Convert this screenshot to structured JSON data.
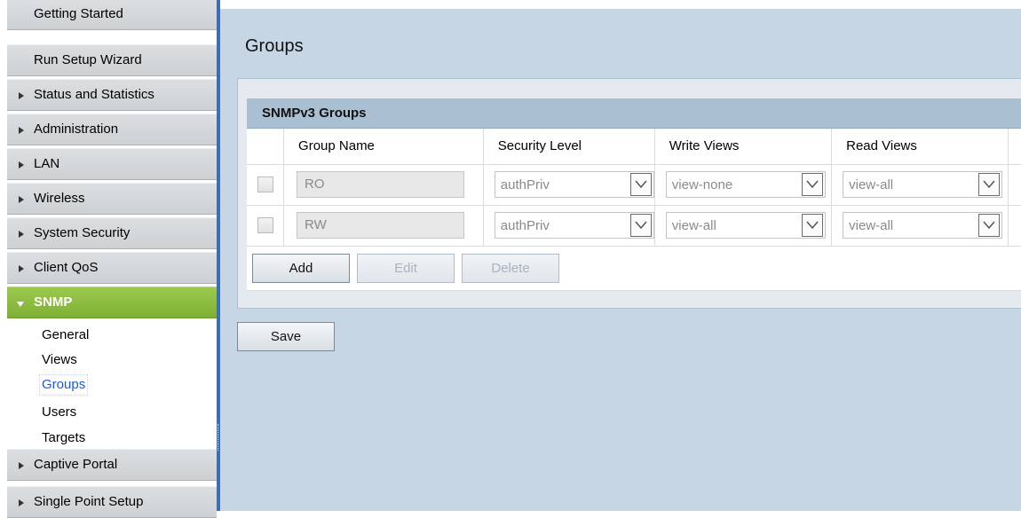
{
  "sidebar": {
    "items": [
      {
        "label": "Getting Started"
      },
      {
        "label": "Run Setup Wizard"
      },
      {
        "label": "Status and Statistics"
      },
      {
        "label": "Administration"
      },
      {
        "label": "LAN"
      },
      {
        "label": "Wireless"
      },
      {
        "label": "System Security"
      },
      {
        "label": "Client QoS"
      },
      {
        "label": "SNMP"
      },
      {
        "label": "Captive Portal"
      },
      {
        "label": "Single Point Setup"
      }
    ],
    "snmp_sub": [
      {
        "label": "General"
      },
      {
        "label": "Views"
      },
      {
        "label": "Groups"
      },
      {
        "label": "Users"
      },
      {
        "label": "Targets"
      }
    ],
    "active_color": "#8dbd42"
  },
  "page": {
    "title": "Groups"
  },
  "panel": {
    "title": "SNMPv3 Groups",
    "columns": [
      "",
      "Group Name",
      "Security Level",
      "Write Views",
      "Read Views"
    ],
    "rows": [
      {
        "name": "RO",
        "security": "authPriv",
        "write": "view-none",
        "read": "view-all"
      },
      {
        "name": "RW",
        "security": "authPriv",
        "write": "view-all",
        "read": "view-all"
      }
    ],
    "buttons": {
      "add": "Add",
      "edit": "Edit",
      "delete": "Delete"
    }
  },
  "save_label": "Save",
  "colors": {
    "accent": "#3a6fb6",
    "main_bg": "#c7d6e4",
    "panel_header": "#a9bfd2"
  }
}
